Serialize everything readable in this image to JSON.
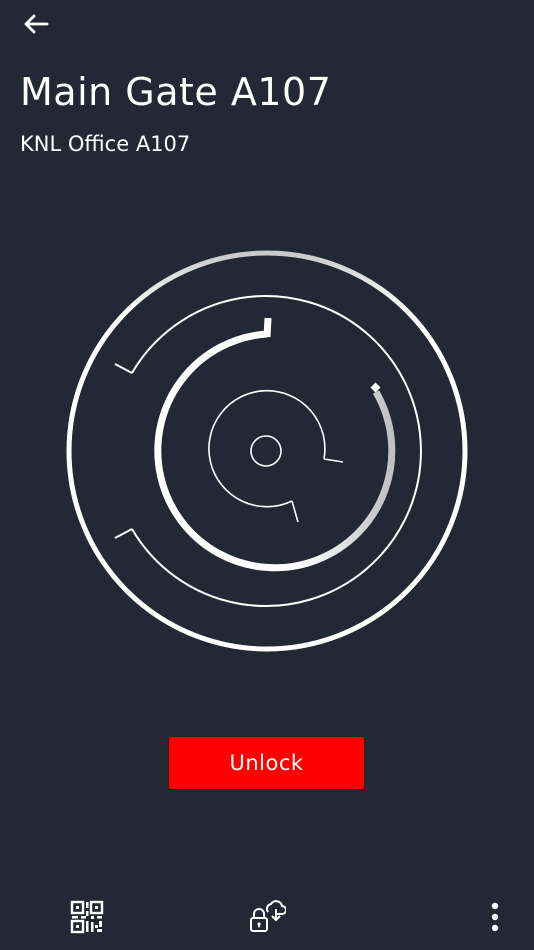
{
  "header": {
    "back_icon": "arrow-left-icon",
    "title": "Main Gate A107",
    "subtitle": "KNL Office A107"
  },
  "lock_graphic": {
    "icon": "concentric-lock-rings-icon"
  },
  "actions": {
    "unlock_label": "Unlock",
    "unlock_color": "#ff0000"
  },
  "bottom_bar": {
    "icons": [
      "qr-code-icon",
      "lock-cloud-sync-icon",
      "more-vertical-icon"
    ]
  },
  "theme": {
    "background": "#232834",
    "foreground": "#ffffff"
  }
}
